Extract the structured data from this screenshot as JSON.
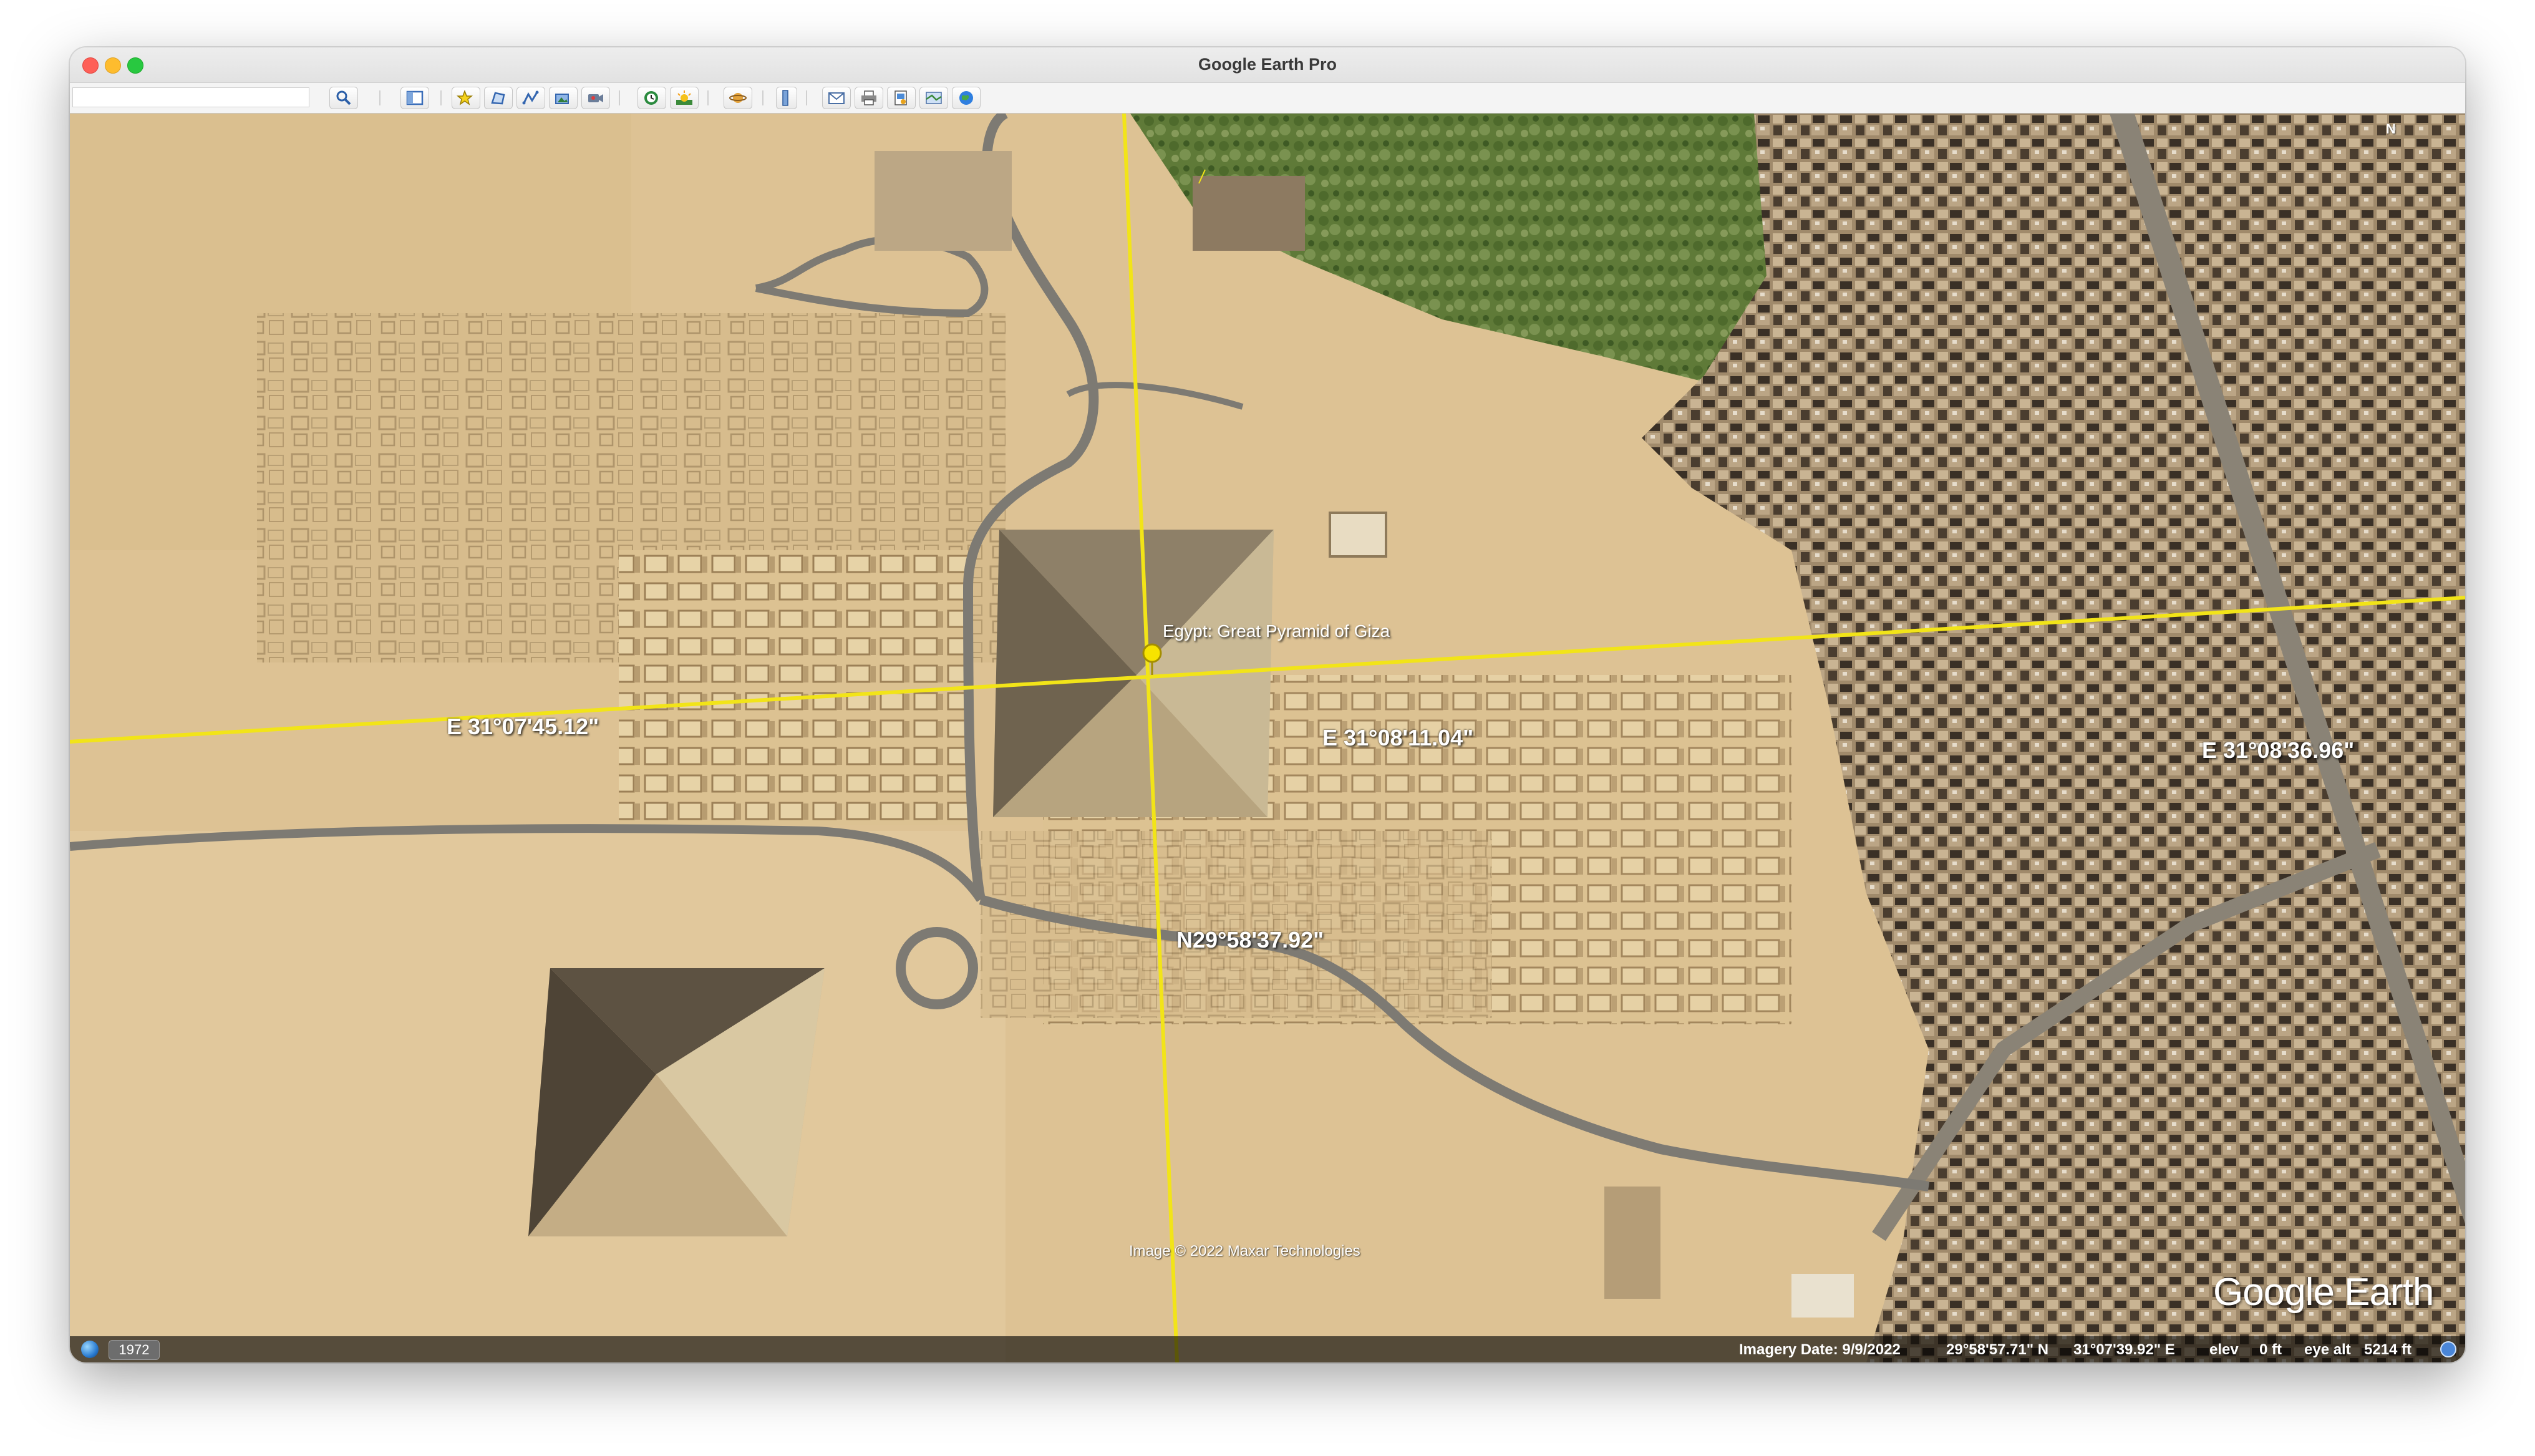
{
  "window": {
    "title": "Google Earth Pro"
  },
  "search": {
    "value": "",
    "placeholder": ""
  },
  "toolbar": {
    "buttons": [
      {
        "icon": "search-icon"
      },
      {
        "icon": "sidebar-toggle-icon"
      },
      {
        "icon": "add-placemark-icon"
      },
      {
        "icon": "add-polygon-icon"
      },
      {
        "icon": "add-path-icon"
      },
      {
        "icon": "add-image-overlay-icon"
      },
      {
        "icon": "record-tour-icon"
      },
      {
        "icon": "historical-imagery-icon"
      },
      {
        "icon": "sunlight-icon"
      },
      {
        "icon": "switch-planet-icon"
      },
      {
        "icon": "ruler-icon"
      },
      {
        "icon": "email-icon"
      },
      {
        "icon": "print-icon"
      },
      {
        "icon": "save-image-icon"
      },
      {
        "icon": "view-in-maps-icon"
      },
      {
        "icon": "earth-globe-icon"
      }
    ]
  },
  "map": {
    "placemark": "Egypt: Great Pyramid of Giza",
    "grid_labels": {
      "lon_west": "E 31°07'45.12\"",
      "lon_center": "E 31°08'11.04\"",
      "lon_east": "E 31°08'36.96\"",
      "lat_center": "N29°58'37.92\""
    },
    "copyright": "Image © 2022 Maxar Technologies",
    "brand": "Google Earth",
    "north_indicator": "N",
    "colors": {
      "grid_line": "#f2e418",
      "sand": "#ddc294",
      "road": "#7d7a73",
      "urban": "#a18c6e",
      "vegetation": "#5f7a38"
    }
  },
  "statusbar": {
    "year": "1972",
    "imagery_date": "Imagery Date: 9/9/2022",
    "latitude": "29°58'57.71\" N",
    "longitude": "31°07'39.92\" E",
    "elev_label": "elev",
    "elev_value": "0 ft",
    "eye_alt_label": "eye alt",
    "eye_alt_value": "5214 ft"
  }
}
